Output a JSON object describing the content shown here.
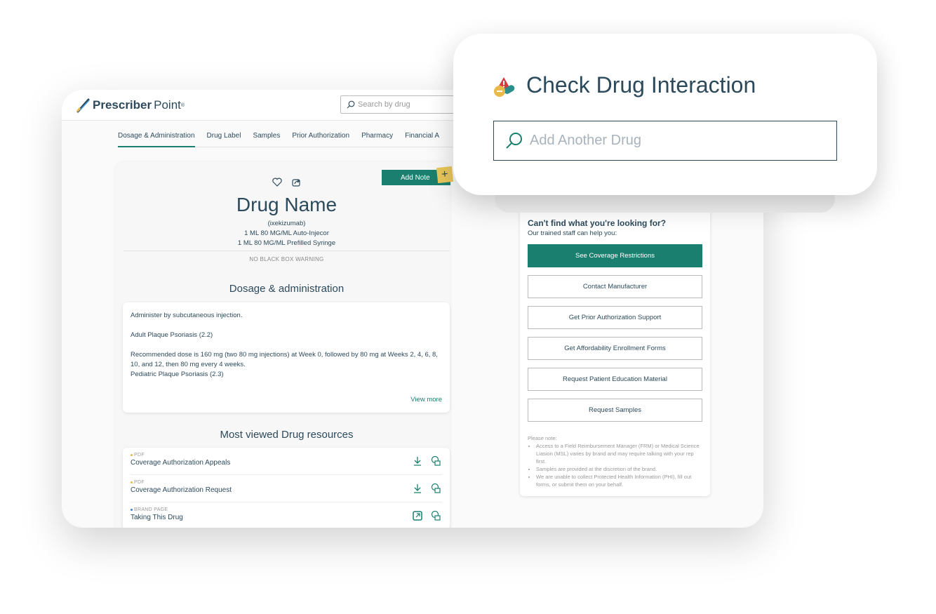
{
  "header": {
    "logo_bold": "Prescriber",
    "logo_light": "Point",
    "logo_mark": "®",
    "search_placeholder": "Search by drug"
  },
  "tabs": [
    {
      "label": "Dosage & Administration",
      "active": true
    },
    {
      "label": "Drug Label"
    },
    {
      "label": "Samples"
    },
    {
      "label": "Prior Authorization"
    },
    {
      "label": "Pharmacy"
    },
    {
      "label": "Financial A"
    }
  ],
  "drug": {
    "add_note": "Add Note",
    "plus": "+",
    "name": "Drug Name",
    "generic": "(ixekizumab)",
    "forms": [
      "1 ML 80 MG/ML Auto-Injecor",
      "1 ML 80 MG/ML Prefilled Syringe"
    ],
    "warning": "NO BLACK BOX WARNING"
  },
  "dosage": {
    "heading": "Dosage & administration",
    "lines": [
      "Administer by subcutaneous injection.",
      "Adult Plaque Psoriasis (2.2)",
      "Recommended dose is 160 mg (two 80 mg injections) at Week 0, followed by 80 mg at Weeks 2, 4, 6, 8, 10, and 12, then 80 mg every 4 weeks.",
      "Pediatric Plaque Psoriasis (2.3)"
    ],
    "view_more": "View more"
  },
  "resources": {
    "heading": "Most viewed Drug resources",
    "items": [
      {
        "type": "PDF",
        "name": "Coverage Authorization Appeals",
        "dot": "#e9b949"
      },
      {
        "type": "PDF",
        "name": "Coverage Authorization Request",
        "dot": "#e9b949"
      },
      {
        "type": "BRAND PAGE",
        "name": "Taking This Drug",
        "dot": "#4a7bd8"
      }
    ]
  },
  "help": {
    "title": "Can't find what you're looking for?",
    "subtitle": "Our trained staff can help you:",
    "buttons": [
      "See Coverage Restrictions",
      "Contact Manufacturer",
      "Get Prior Authorization Support",
      "Get Affordability Enrollment Forms",
      "Request Patient Education Material",
      "Request Samples"
    ],
    "note_title": "Please note:",
    "notes": [
      "Access to a Field Reimbursement Manager (FRM) or Medical Science Liasion (MSL) varies by brand and may require talking with your rep first.",
      "Samples are provided at the discretion of the brand.",
      "We are unable to collect Protected Health Information (PHI), fill out forms, or submit them on your behalf."
    ]
  },
  "popup": {
    "title": "Check Drug Interaction",
    "placeholder": "Add Another Drug"
  },
  "colors": {
    "accent": "#1a7f6e",
    "text": "#2c4a5c",
    "note": "#e9c75a"
  }
}
